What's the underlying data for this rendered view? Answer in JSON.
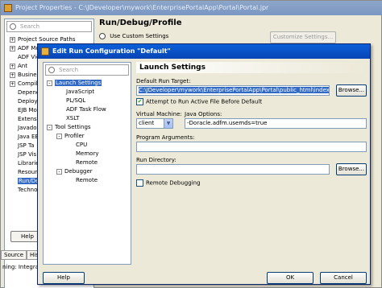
{
  "background_window": {
    "title": "Project Properties - C:\\JDeveloper\\mywork\\EnterprisePortalApp\\Portal\\Portal.jpr",
    "search_placeholder": "Search",
    "tree": [
      {
        "label": "Project Source Paths",
        "pm": "+"
      },
      {
        "label": "ADF Mo",
        "pm": "+"
      },
      {
        "label": "ADF Vie",
        "pm": ""
      },
      {
        "label": "Ant",
        "pm": "+"
      },
      {
        "label": "Busine",
        "pm": "+"
      },
      {
        "label": "Compile",
        "pm": "+"
      },
      {
        "label": "Depend",
        "pm": ""
      },
      {
        "label": "Deploy",
        "pm": ""
      },
      {
        "label": "EJB Mo",
        "pm": ""
      },
      {
        "label": "Extensi",
        "pm": ""
      },
      {
        "label": "Javado",
        "pm": ""
      },
      {
        "label": "Java EE",
        "pm": ""
      },
      {
        "label": "JSP Ta",
        "pm": ""
      },
      {
        "label": "JSP Vis",
        "pm": ""
      },
      {
        "label": "Librarie",
        "pm": ""
      },
      {
        "label": "Resour",
        "pm": ""
      },
      {
        "label": "Run/De",
        "pm": ""
      },
      {
        "label": "Technol",
        "pm": ""
      }
    ],
    "section_title": "Run/Debug/Profile",
    "custom_settings_label": "Use Custom Settings",
    "customize_button": "Customize Settings...",
    "help_button": "Help",
    "tabs": [
      "Source",
      "Histo"
    ],
    "status": "ning: Integrat"
  },
  "dialog": {
    "title": "Edit Run Configuration \"Default\"",
    "search_placeholder": "Search",
    "nav": [
      {
        "label": "Launch Settings",
        "level": 0,
        "pm": "-",
        "selected": true
      },
      {
        "label": "JavaScript",
        "level": 1
      },
      {
        "label": "PL/SQL",
        "level": 1
      },
      {
        "label": "ADF Task Flow",
        "level": 1
      },
      {
        "label": "XSLT",
        "level": 1
      },
      {
        "label": "Tool Settings",
        "level": 0,
        "pm": "-"
      },
      {
        "label": "Profiler",
        "level": 1,
        "pm": "-"
      },
      {
        "label": "CPU",
        "level": 2
      },
      {
        "label": "Memory",
        "level": 2
      },
      {
        "label": "Remote",
        "level": 2
      },
      {
        "label": "Debugger",
        "level": 1,
        "pm": "-"
      },
      {
        "label": "Remote",
        "level": 2
      }
    ],
    "settings_title": "Launch Settings",
    "default_run_target_label": "Default Run Target:",
    "default_run_target_value": "C:\\JDeveloper\\mywork\\EnterprisePortalApp\\Portal\\public_html\\index.html",
    "browse_label": "Browse...",
    "attempt_label": "Attempt to Run Active File Before Default",
    "vm_label": "Virtual Machine:",
    "vm_value": "client",
    "java_options_label": "Java Options:",
    "java_options_value": "-Doracle.adfm.usemds=true",
    "program_args_label": "Program Arguments:",
    "program_args_value": "",
    "run_dir_label": "Run Directory:",
    "run_dir_value": "",
    "remote_debugging_label": "Remote Debugging",
    "help_button": "Help",
    "ok_button": "OK",
    "cancel_button": "Cancel"
  }
}
